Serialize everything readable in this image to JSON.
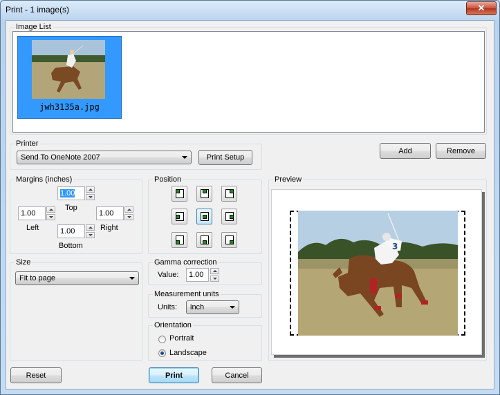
{
  "window": {
    "title": "Print  -  1 image(s)",
    "close_glyph": "✕"
  },
  "image_list": {
    "legend": "Image List",
    "items": [
      {
        "filename": "jwh3135a.jpg",
        "selected": true
      }
    ]
  },
  "printer": {
    "legend": "Printer",
    "selected": "Send To OneNote 2007",
    "setup_label": "Print Setup"
  },
  "list_buttons": {
    "add_label": "Add",
    "remove_label": "Remove"
  },
  "margins": {
    "legend": "Margins (inches)",
    "top_value": "1.00",
    "top_label": "Top",
    "left_value": "1.00",
    "left_label": "Left",
    "right_value": "1.00",
    "right_label": "Right",
    "bottom_value": "1.00",
    "bottom_label": "Bottom"
  },
  "position": {
    "legend": "Position",
    "selected": "center"
  },
  "preview": {
    "legend": "Preview"
  },
  "size": {
    "legend": "Size",
    "selected": "Fit to page"
  },
  "gamma": {
    "legend": "Gamma correction",
    "value_label": "Value:",
    "value": "1.00"
  },
  "units": {
    "legend": "Measurement units",
    "units_label": "Units:",
    "selected": "inch"
  },
  "orientation": {
    "legend": "Orientation",
    "portrait_label": "Portrait",
    "landscape_label": "Landscape",
    "selected": "Landscape"
  },
  "footer": {
    "reset_label": "Reset",
    "print_label": "Print",
    "cancel_label": "Cancel"
  },
  "colors": {
    "selection": "#3399ff",
    "accent_green": "#1a8c1a"
  }
}
